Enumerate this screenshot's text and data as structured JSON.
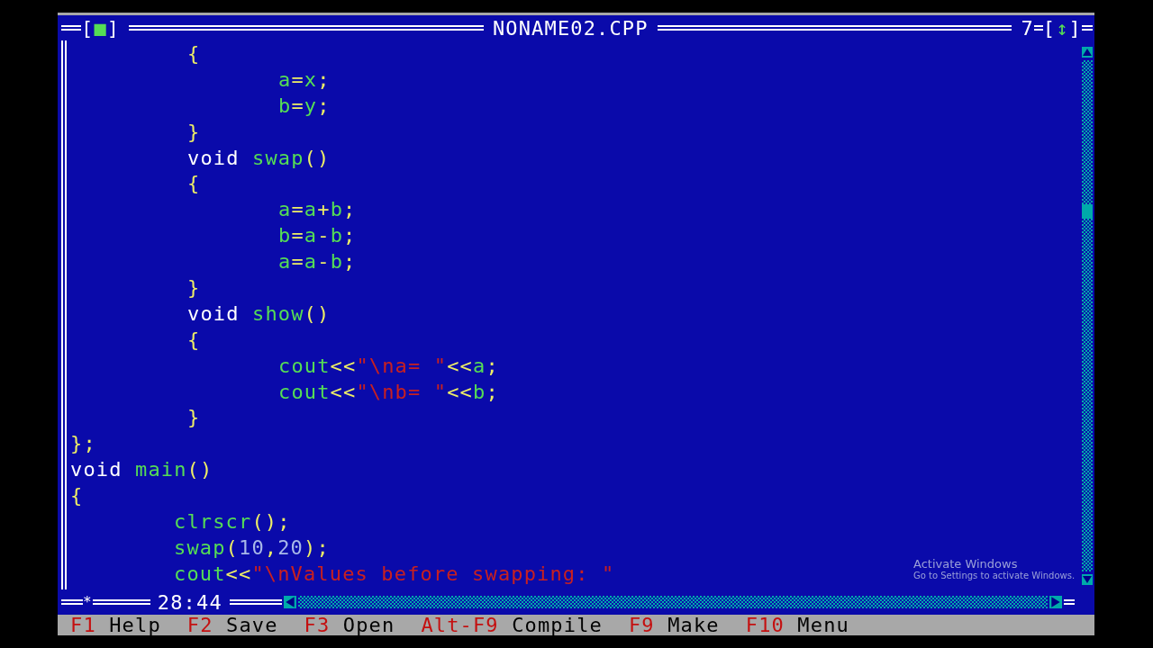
{
  "window": {
    "close_button": "[■]",
    "title": "NONAME02.CPP",
    "number": "7",
    "zoom_button": "[↕]"
  },
  "code_lines": [
    {
      "kind": "member",
      "tokens": [
        {
          "text": "{",
          "kind": "symbol"
        }
      ]
    },
    {
      "kind": "statement",
      "tokens": [
        {
          "text": "a",
          "kind": "ident"
        },
        {
          "text": "=",
          "kind": "symbol"
        },
        {
          "text": "x",
          "kind": "ident"
        },
        {
          "text": ";",
          "kind": "symbol"
        }
      ]
    },
    {
      "kind": "statement",
      "tokens": [
        {
          "text": "b",
          "kind": "ident"
        },
        {
          "text": "=",
          "kind": "symbol"
        },
        {
          "text": "y",
          "kind": "ident"
        },
        {
          "text": ";",
          "kind": "symbol"
        }
      ]
    },
    {
      "kind": "member",
      "tokens": [
        {
          "text": "}",
          "kind": "symbol"
        }
      ]
    },
    {
      "kind": "member",
      "tokens": [
        {
          "text": "void",
          "kind": "keyword"
        },
        {
          "text": " swap",
          "kind": "ident"
        },
        {
          "text": "()",
          "kind": "symbol"
        }
      ]
    },
    {
      "kind": "member",
      "tokens": [
        {
          "text": "{",
          "kind": "symbol"
        }
      ]
    },
    {
      "kind": "statement",
      "tokens": [
        {
          "text": "a",
          "kind": "ident"
        },
        {
          "text": "=",
          "kind": "symbol"
        },
        {
          "text": "a",
          "kind": "ident"
        },
        {
          "text": "+",
          "kind": "symbol"
        },
        {
          "text": "b",
          "kind": "ident"
        },
        {
          "text": ";",
          "kind": "symbol"
        }
      ]
    },
    {
      "kind": "statement",
      "tokens": [
        {
          "text": "b",
          "kind": "ident"
        },
        {
          "text": "=",
          "kind": "symbol"
        },
        {
          "text": "a",
          "kind": "ident"
        },
        {
          "text": "-",
          "kind": "symbol"
        },
        {
          "text": "b",
          "kind": "ident"
        },
        {
          "text": ";",
          "kind": "symbol"
        }
      ]
    },
    {
      "kind": "statement",
      "tokens": [
        {
          "text": "a",
          "kind": "ident"
        },
        {
          "text": "=",
          "kind": "symbol"
        },
        {
          "text": "a",
          "kind": "ident"
        },
        {
          "text": "-",
          "kind": "symbol"
        },
        {
          "text": "b",
          "kind": "ident"
        },
        {
          "text": ";",
          "kind": "symbol"
        }
      ]
    },
    {
      "kind": "member",
      "tokens": [
        {
          "text": "}",
          "kind": "symbol"
        }
      ]
    },
    {
      "kind": "member",
      "tokens": [
        {
          "text": "void",
          "kind": "keyword"
        },
        {
          "text": " show",
          "kind": "ident"
        },
        {
          "text": "()",
          "kind": "symbol"
        }
      ]
    },
    {
      "kind": "member",
      "tokens": [
        {
          "text": "{",
          "kind": "symbol"
        }
      ]
    },
    {
      "kind": "statement",
      "tokens": [
        {
          "text": "cout",
          "kind": "ident"
        },
        {
          "text": "<<",
          "kind": "symbol"
        },
        {
          "text": "\"\\na= \"",
          "kind": "string"
        },
        {
          "text": "<<",
          "kind": "symbol"
        },
        {
          "text": "a",
          "kind": "ident"
        },
        {
          "text": ";",
          "kind": "symbol"
        }
      ]
    },
    {
      "kind": "statement",
      "tokens": [
        {
          "text": "cout",
          "kind": "ident"
        },
        {
          "text": "<<",
          "kind": "symbol"
        },
        {
          "text": "\"\\nb= \"",
          "kind": "string"
        },
        {
          "text": "<<",
          "kind": "symbol"
        },
        {
          "text": "b",
          "kind": "ident"
        },
        {
          "text": ";",
          "kind": "symbol"
        }
      ]
    },
    {
      "kind": "member",
      "tokens": [
        {
          "text": "}",
          "kind": "symbol"
        }
      ]
    },
    {
      "kind": "top",
      "tokens": [
        {
          "text": "};",
          "kind": "symbol"
        }
      ]
    },
    {
      "kind": "top",
      "tokens": [
        {
          "text": "void",
          "kind": "keyword"
        },
        {
          "text": " main",
          "kind": "ident"
        },
        {
          "text": "()",
          "kind": "symbol"
        }
      ]
    },
    {
      "kind": "top",
      "tokens": [
        {
          "text": "{",
          "kind": "symbol"
        }
      ]
    },
    {
      "kind": "main_statement",
      "tokens": [
        {
          "text": "clrscr",
          "kind": "ident"
        },
        {
          "text": "();",
          "kind": "symbol"
        }
      ]
    },
    {
      "kind": "main_statement",
      "tokens": [
        {
          "text": "swap",
          "kind": "ident"
        },
        {
          "text": "(",
          "kind": "symbol"
        },
        {
          "text": "10",
          "kind": "number"
        },
        {
          "text": ",",
          "kind": "symbol"
        },
        {
          "text": "20",
          "kind": "number"
        },
        {
          "text": ");",
          "kind": "symbol"
        }
      ]
    },
    {
      "kind": "main_statement",
      "tokens": [
        {
          "text": "cout",
          "kind": "ident"
        },
        {
          "text": "<<",
          "kind": "symbol"
        },
        {
          "text": "\"\\nValues before swapping: \"",
          "kind": "string"
        }
      ]
    }
  ],
  "status": {
    "modified_mark": "*",
    "cursor_position": "28:44"
  },
  "function_keys": [
    {
      "key": "F1",
      "label": "Help"
    },
    {
      "key": "F2",
      "label": "Save"
    },
    {
      "key": "F3",
      "label": "Open"
    },
    {
      "key": "Alt-F9",
      "label": "Compile"
    },
    {
      "key": "F9",
      "label": "Make"
    },
    {
      "key": "F10",
      "label": "Menu"
    }
  ],
  "os_notice": {
    "title": "Activate Windows",
    "message": "Go to Settings to activate Windows."
  }
}
